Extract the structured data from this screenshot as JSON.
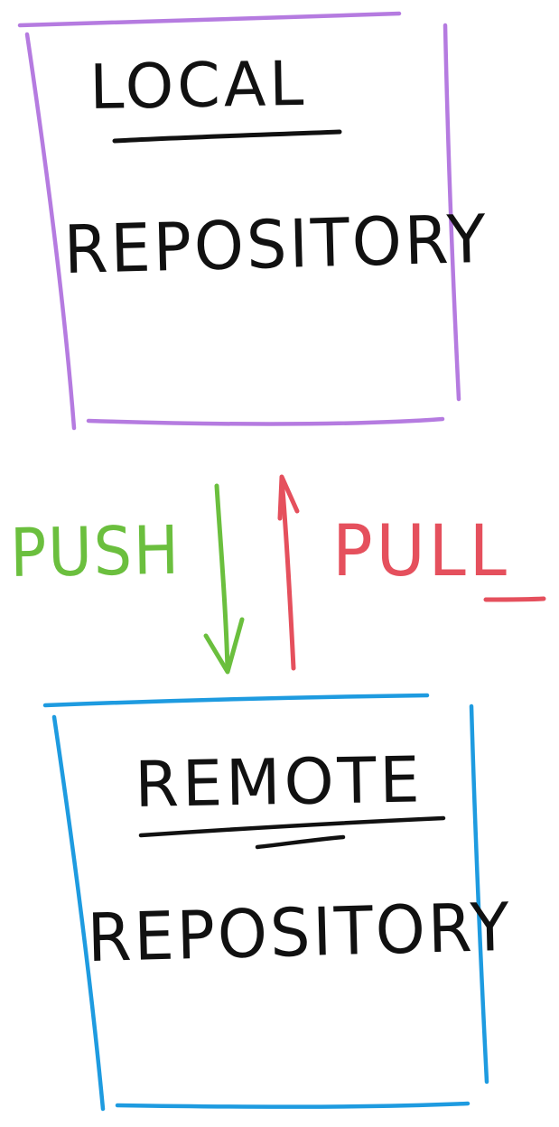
{
  "local_box": {
    "title": "LOCAL",
    "subtitle": "REPOSITORY",
    "color": "#b57be0"
  },
  "remote_box": {
    "title": "REMOTE",
    "subtitle": "REPOSITORY",
    "color": "#1e9be0"
  },
  "push": {
    "label": "PUSH",
    "color": "#6bbf3e",
    "direction": "down"
  },
  "pull": {
    "label": "PULL",
    "color": "#e5505d",
    "direction": "up"
  },
  "ink_color": "#111111"
}
